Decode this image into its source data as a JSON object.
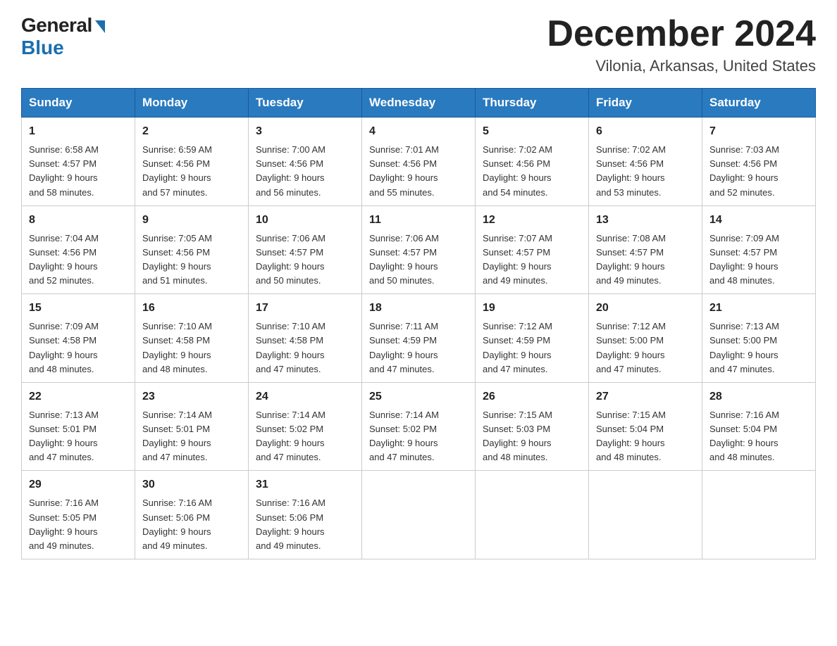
{
  "logo": {
    "general": "General",
    "blue": "Blue"
  },
  "title": "December 2024",
  "subtitle": "Vilonia, Arkansas, United States",
  "days_of_week": [
    "Sunday",
    "Monday",
    "Tuesday",
    "Wednesday",
    "Thursday",
    "Friday",
    "Saturday"
  ],
  "weeks": [
    [
      {
        "day": "1",
        "sunrise": "6:58 AM",
        "sunset": "4:57 PM",
        "daylight": "9 hours and 58 minutes."
      },
      {
        "day": "2",
        "sunrise": "6:59 AM",
        "sunset": "4:56 PM",
        "daylight": "9 hours and 57 minutes."
      },
      {
        "day": "3",
        "sunrise": "7:00 AM",
        "sunset": "4:56 PM",
        "daylight": "9 hours and 56 minutes."
      },
      {
        "day": "4",
        "sunrise": "7:01 AM",
        "sunset": "4:56 PM",
        "daylight": "9 hours and 55 minutes."
      },
      {
        "day": "5",
        "sunrise": "7:02 AM",
        "sunset": "4:56 PM",
        "daylight": "9 hours and 54 minutes."
      },
      {
        "day": "6",
        "sunrise": "7:02 AM",
        "sunset": "4:56 PM",
        "daylight": "9 hours and 53 minutes."
      },
      {
        "day": "7",
        "sunrise": "7:03 AM",
        "sunset": "4:56 PM",
        "daylight": "9 hours and 52 minutes."
      }
    ],
    [
      {
        "day": "8",
        "sunrise": "7:04 AM",
        "sunset": "4:56 PM",
        "daylight": "9 hours and 52 minutes."
      },
      {
        "day": "9",
        "sunrise": "7:05 AM",
        "sunset": "4:56 PM",
        "daylight": "9 hours and 51 minutes."
      },
      {
        "day": "10",
        "sunrise": "7:06 AM",
        "sunset": "4:57 PM",
        "daylight": "9 hours and 50 minutes."
      },
      {
        "day": "11",
        "sunrise": "7:06 AM",
        "sunset": "4:57 PM",
        "daylight": "9 hours and 50 minutes."
      },
      {
        "day": "12",
        "sunrise": "7:07 AM",
        "sunset": "4:57 PM",
        "daylight": "9 hours and 49 minutes."
      },
      {
        "day": "13",
        "sunrise": "7:08 AM",
        "sunset": "4:57 PM",
        "daylight": "9 hours and 49 minutes."
      },
      {
        "day": "14",
        "sunrise": "7:09 AM",
        "sunset": "4:57 PM",
        "daylight": "9 hours and 48 minutes."
      }
    ],
    [
      {
        "day": "15",
        "sunrise": "7:09 AM",
        "sunset": "4:58 PM",
        "daylight": "9 hours and 48 minutes."
      },
      {
        "day": "16",
        "sunrise": "7:10 AM",
        "sunset": "4:58 PM",
        "daylight": "9 hours and 48 minutes."
      },
      {
        "day": "17",
        "sunrise": "7:10 AM",
        "sunset": "4:58 PM",
        "daylight": "9 hours and 47 minutes."
      },
      {
        "day": "18",
        "sunrise": "7:11 AM",
        "sunset": "4:59 PM",
        "daylight": "9 hours and 47 minutes."
      },
      {
        "day": "19",
        "sunrise": "7:12 AM",
        "sunset": "4:59 PM",
        "daylight": "9 hours and 47 minutes."
      },
      {
        "day": "20",
        "sunrise": "7:12 AM",
        "sunset": "5:00 PM",
        "daylight": "9 hours and 47 minutes."
      },
      {
        "day": "21",
        "sunrise": "7:13 AM",
        "sunset": "5:00 PM",
        "daylight": "9 hours and 47 minutes."
      }
    ],
    [
      {
        "day": "22",
        "sunrise": "7:13 AM",
        "sunset": "5:01 PM",
        "daylight": "9 hours and 47 minutes."
      },
      {
        "day": "23",
        "sunrise": "7:14 AM",
        "sunset": "5:01 PM",
        "daylight": "9 hours and 47 minutes."
      },
      {
        "day": "24",
        "sunrise": "7:14 AM",
        "sunset": "5:02 PM",
        "daylight": "9 hours and 47 minutes."
      },
      {
        "day": "25",
        "sunrise": "7:14 AM",
        "sunset": "5:02 PM",
        "daylight": "9 hours and 47 minutes."
      },
      {
        "day": "26",
        "sunrise": "7:15 AM",
        "sunset": "5:03 PM",
        "daylight": "9 hours and 48 minutes."
      },
      {
        "day": "27",
        "sunrise": "7:15 AM",
        "sunset": "5:04 PM",
        "daylight": "9 hours and 48 minutes."
      },
      {
        "day": "28",
        "sunrise": "7:16 AM",
        "sunset": "5:04 PM",
        "daylight": "9 hours and 48 minutes."
      }
    ],
    [
      {
        "day": "29",
        "sunrise": "7:16 AM",
        "sunset": "5:05 PM",
        "daylight": "9 hours and 49 minutes."
      },
      {
        "day": "30",
        "sunrise": "7:16 AM",
        "sunset": "5:06 PM",
        "daylight": "9 hours and 49 minutes."
      },
      {
        "day": "31",
        "sunrise": "7:16 AM",
        "sunset": "5:06 PM",
        "daylight": "9 hours and 49 minutes."
      },
      null,
      null,
      null,
      null
    ]
  ],
  "labels": {
    "sunrise": "Sunrise: ",
    "sunset": "Sunset: ",
    "daylight": "Daylight: "
  },
  "colors": {
    "header_bg": "#2a7abf",
    "header_text": "#ffffff",
    "logo_blue": "#1a6faf"
  }
}
